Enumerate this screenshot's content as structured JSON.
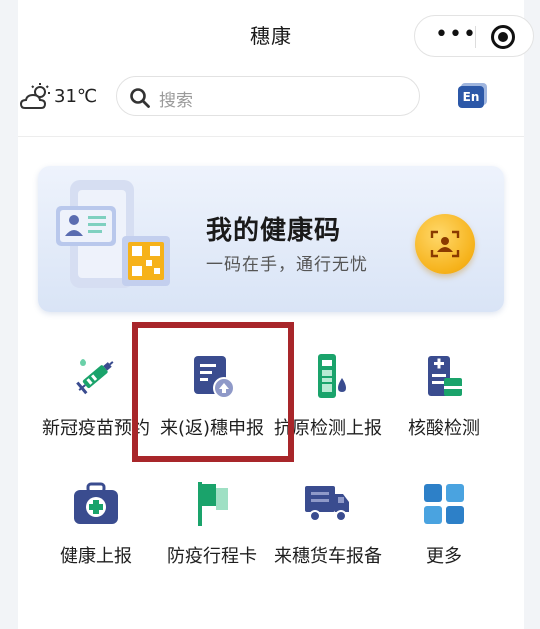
{
  "header": {
    "title": "穗康",
    "menu_glyph": "•••"
  },
  "weather": {
    "temperature": "31℃",
    "icon": "partly-cloudy-icon"
  },
  "search": {
    "placeholder": "搜索"
  },
  "language_toggle": {
    "label": "En"
  },
  "health_code_card": {
    "title": "我的健康码",
    "subtitle": "一码在手，通行无忧",
    "action_icon": "scan-face-icon",
    "accent_color": "#f6b21a"
  },
  "services": [
    {
      "label": "新冠疫苗预约",
      "icon": "vaccine-syringe-icon"
    },
    {
      "label": "来(返)穗申报",
      "icon": "declaration-upload-icon"
    },
    {
      "label": "抗原检测上报",
      "icon": "antigen-test-icon"
    },
    {
      "label": "核酸检测",
      "icon": "nucleic-acid-test-icon"
    },
    {
      "label": "健康上报",
      "icon": "medical-kit-icon"
    },
    {
      "label": "防疫行程卡",
      "icon": "itinerary-flag-icon"
    },
    {
      "label": "来穗货车报备",
      "icon": "truck-icon"
    },
    {
      "label": "更多",
      "icon": "more-grid-icon"
    }
  ],
  "colors": {
    "brand_blue": "#3a4c8f",
    "green": "#1aa36b",
    "highlight_red": "#a8262a"
  }
}
